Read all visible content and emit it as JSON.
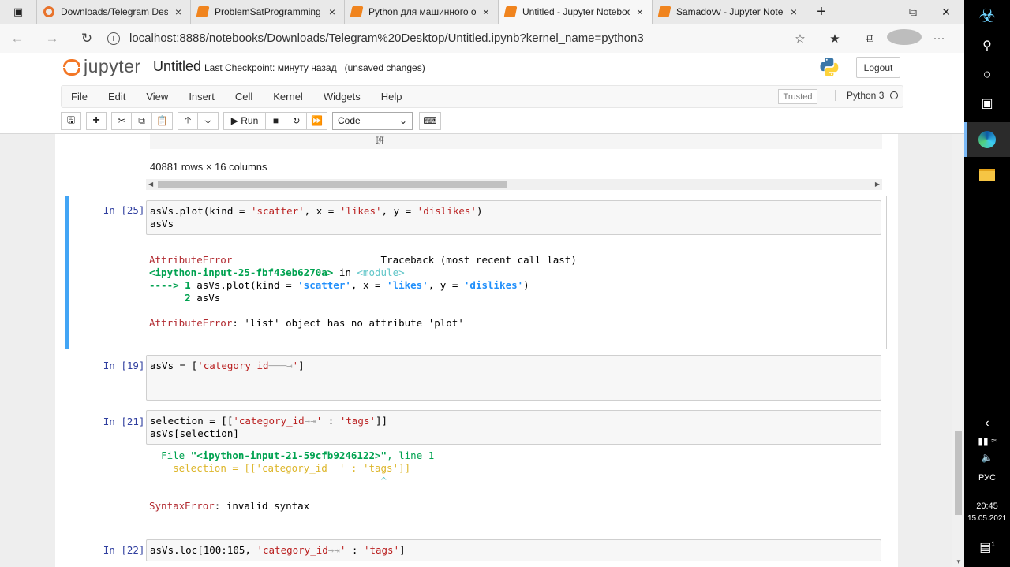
{
  "browser": {
    "tabs": [
      {
        "title": "Downloads/Telegram Desktop",
        "favicon": "chrome-icon"
      },
      {
        "title": "ProblemSatProgramming -",
        "favicon": "jupyter-icon"
      },
      {
        "title": "Python для машинного обучения",
        "favicon": "jupyter-icon"
      },
      {
        "title": "Untitled - Jupyter Notebook",
        "favicon": "jupyter-icon",
        "active": true
      },
      {
        "title": "Samadovv - Jupyter Notebook",
        "favicon": "jupyter-icon"
      }
    ],
    "url": "localhost:8888/notebooks/Downloads/Telegram%20Desktop/Untitled.ipynb?kernel_name=python3"
  },
  "jupyter": {
    "logo_text": "jupyter",
    "notebook_name": "Untitled",
    "checkpoint": "Last Checkpoint: минуту назад",
    "unsaved": "(unsaved changes)",
    "logout": "Logout",
    "menu": [
      "File",
      "Edit",
      "View",
      "Insert",
      "Cell",
      "Kernel",
      "Widgets",
      "Help"
    ],
    "trusted": "Trusted",
    "kernel": "Python 3",
    "run_label": "Run",
    "cell_type": "Code"
  },
  "notebook": {
    "prev_output_glyph": "班",
    "rows_cols": "40881 rows × 16 columns",
    "cells": [
      {
        "prompt": "In [25]:",
        "input_lines": [
          "asVs.plot(kind = 'scatter', x = 'likes', y = 'dislikes')",
          "asVs"
        ],
        "error": {
          "separator": "---------------------------------------------------------------------------",
          "name": "AttributeError",
          "traceback_label": "Traceback (most recent call last)",
          "location": "<ipython-input-25-fbf43eb6270a>",
          "in": "in",
          "module": "<module>",
          "arrow_line": "----> 1 asVs.plot(kind = 'scatter', x = 'likes', y = 'dislikes')",
          "line2": "      2 asVs",
          "message": "'list' object has no attribute 'plot'"
        }
      },
      {
        "prompt": "In [19]:",
        "input_lines": [
          "asVs = ['category_id───⇥']"
        ]
      },
      {
        "prompt": "In [21]:",
        "input_lines": [
          "selection = [['category_id→⇥' : 'tags']]",
          "asVs[selection]"
        ],
        "error": {
          "file_line": "  File \"<ipython-input-21-59cfb9246122>\", line 1",
          "code_line": "    selection = [['category_id  ' : 'tags']]",
          "caret": "                                       ^",
          "name": "SyntaxError",
          "message": "invalid syntax"
        }
      },
      {
        "prompt": "In [22]:",
        "input_lines": [
          "asVs.loc[100:105, 'category_id→⇥' : 'tags']"
        ]
      }
    ]
  },
  "system": {
    "language": "РУС",
    "time": "20:45",
    "date": "15.05.2021",
    "notification_count": "1"
  },
  "colors": {
    "accent_selected": "#42a5f5",
    "prompt": "#303f9f",
    "error": "#b22b31",
    "jupyter_orange": "#f37726"
  }
}
